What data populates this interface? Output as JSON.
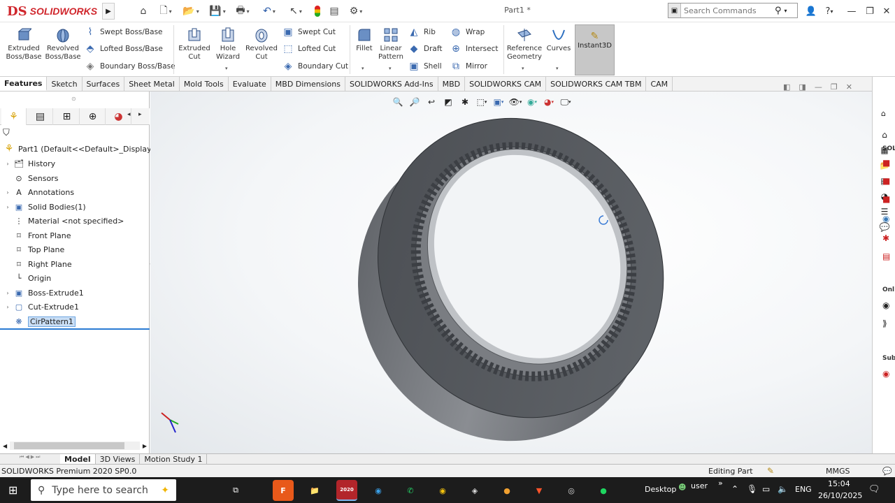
{
  "app": {
    "brand_prefix": "DS",
    "brand": "SOLIDWORKS",
    "doc_title": "Part1 *"
  },
  "search": {
    "placeholder": "Search Commands"
  },
  "ribbon": {
    "extruded_boss": "Extruded Boss/Base",
    "revolved_boss": "Revolved Boss/Base",
    "swept_boss": "Swept Boss/Base",
    "lofted_boss": "Lofted Boss/Base",
    "boundary_boss": "Boundary Boss/Base",
    "extruded_cut": "Extruded Cut",
    "hole_wizard": "Hole Wizard",
    "revolved_cut": "Revolved Cut",
    "swept_cut": "Swept Cut",
    "lofted_cut": "Lofted Cut",
    "boundary_cut": "Boundary Cut",
    "fillet": "Fillet",
    "linear_pattern": "Linear Pattern",
    "rib": "Rib",
    "draft": "Draft",
    "shell": "Shell",
    "wrap": "Wrap",
    "intersect": "Intersect",
    "mirror": "Mirror",
    "reference_geometry": "Reference Geometry",
    "curves": "Curves",
    "instant3d": "Instant3D"
  },
  "tabs": [
    "Features",
    "Sketch",
    "Surfaces",
    "Sheet Metal",
    "Mold Tools",
    "Evaluate",
    "MBD Dimensions",
    "SOLIDWORKS Add-Ins",
    "MBD",
    "SOLIDWORKS CAM",
    "SOLIDWORKS CAM TBM",
    "CAM"
  ],
  "tree": {
    "root": "Part1  (Default<<Default>_Display Sta",
    "items": [
      "History",
      "Sensors",
      "Annotations",
      "Solid Bodies(1)",
      "Material <not specified>",
      "Front Plane",
      "Top Plane",
      "Right Plane",
      "Origin",
      "Boss-Extrude1",
      "Cut-Extrude1",
      "CirPattern1"
    ]
  },
  "bottom_tabs": [
    "Model",
    "3D Views",
    "Motion Study 1"
  ],
  "status": {
    "left": "SOLIDWORKS Premium 2020 SP0.0",
    "mode": "Editing Part",
    "units": "MMGS"
  },
  "taskpane_labels": [
    "SOL",
    "Onl",
    "Sub"
  ],
  "taskbar": {
    "search_placeholder": "Type here to search",
    "desktop": "Desktop",
    "user": "user",
    "lang": "ENG",
    "time": "15:04",
    "date": "26/10/2025",
    "sw_badge": "2020"
  },
  "colors": {
    "accent": "#d0262c",
    "selection": "#c9def5",
    "part": "#5b5e63"
  }
}
